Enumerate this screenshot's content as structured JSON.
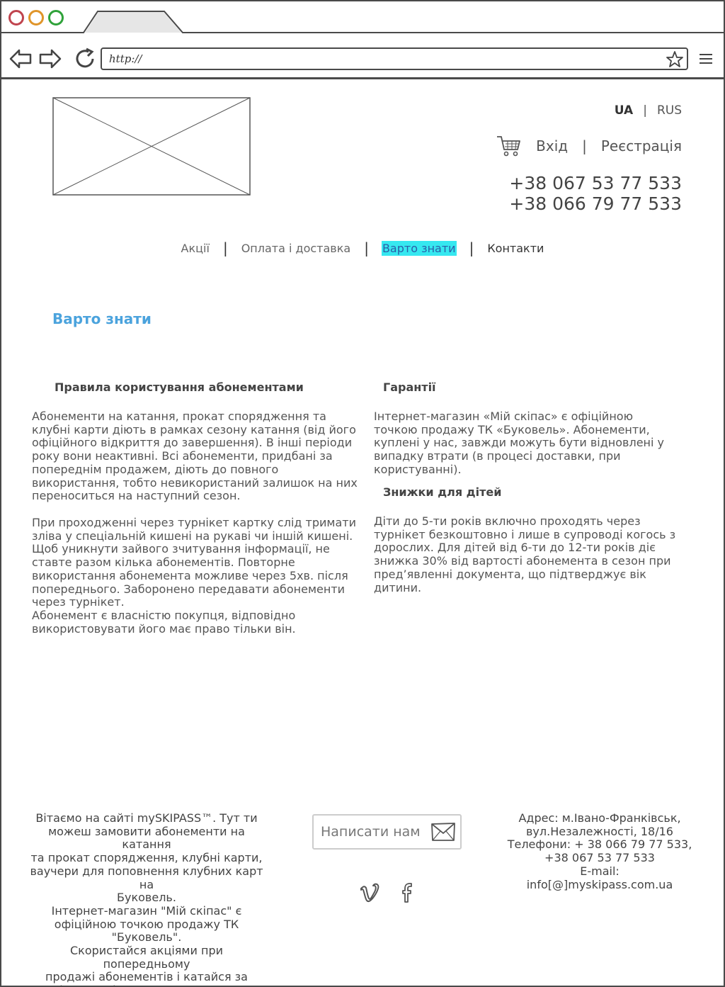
{
  "browser": {
    "url": "http://"
  },
  "header": {
    "lang_active": "UA",
    "lang_sep": "|",
    "lang_other": "RUS",
    "login": "Вхід",
    "auth_sep": "|",
    "register": "Реєстрація",
    "phone_1": "+38 067 53 77 533",
    "phone_2": "+38 066 79 77 533"
  },
  "nav": {
    "items": [
      {
        "label": "Акції"
      },
      {
        "label": "Оплата і доставка"
      },
      {
        "label": "Варто знати"
      },
      {
        "label": "Контакти"
      }
    ],
    "sep": "|"
  },
  "page": {
    "title": "Варто знати"
  },
  "sections": {
    "rules": {
      "heading": "Правила користування абонементами",
      "p1": "Абонементи на катання, прокат спорядження та клубні карти діють в рамках сезону катання (від його офіційного відкриття до завершення). В інші періоди року вони неактивні. Всі абонементи, придбані за попереднім продажем, діють до повного використання, тобто невикористаний залишок на них переноситься на наступний сезон.",
      "p2": "При проходженні через турнікет картку слід тримати зліва у спеціальній кишені на рукаві чи іншій кишені. Щоб уникнути зайвого зчитування інформації, не ставте разом кілька абонементів. Повторне використання абонемента можливе через 5хв. після попереднього. Заборонено передавати абонементи через турнікет.",
      "p3": "Абонемент є власністю покупця, відповідно використовувати його має право тільки він."
    },
    "guarantees": {
      "heading": "Гарантії",
      "p1": "Інтернет-магазин «Мій скіпас» є офіційною точкою продажу ТК «Буковель». Абонементи, куплені у нас, завжди можуть бути відновлені у випадку втрати (в процесі доставки, при користуванні)."
    },
    "kids": {
      "heading": "Знижки для дітей",
      "p1": "Діти до 5-ти років включно проходять через турнікет безкоштовно і лише в супроводі когось з дорослих. Для дітей від 6-ти до 12-ти років діє знижка 30% від вартості абонемента в сезон при пред’явленні документа, що підтверджує вік дитини."
    }
  },
  "footer": {
    "about": "Вітаємо на сайті mySKIPASS™. Тут ти\nможеш замовити абонементи на катання\nта прокат спорядження, клубні карти,\nваучери для поповнення клубних карт на\nБуковель.\nІнтернет-магазин \"Мій скіпас\" є\nофіційною точкою продажу ТК \"Буковель\".\nСкористайся акціями при попередньому\nпродажі абонементів і катайся за\nвигідними цінами протягом сезону. Свій\nскіпас купи у нас :)",
    "write_label": "Написати нам",
    "contacts": "Адрес: м.Івано-Франківськ,\nвул.Незалежності, 18/16\nТелефони: + 38 066 79 77 533,\n+38 067 53 77 533\nE-mail:\ninfo[@]myskipass.com.ua"
  }
}
